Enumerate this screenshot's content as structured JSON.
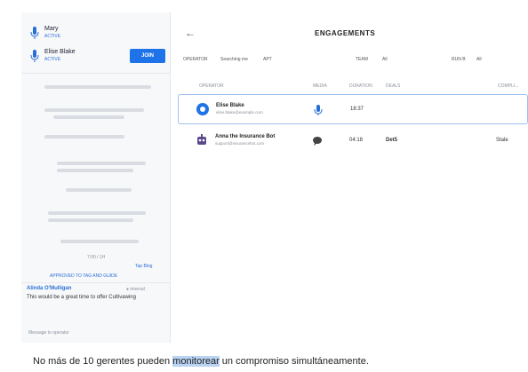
{
  "sidebar": {
    "agents": [
      {
        "name": "Mary",
        "status": "ACTIVE"
      },
      {
        "name": "Elise Blake",
        "status": "ACTIVE"
      }
    ],
    "join_label": "JOIN",
    "time_label": "7:00 / 1H",
    "show_link": "Tap Blog",
    "reply_link": "APPROVED TO TAG AND GUIDE",
    "chat": {
      "author": "Alinda O'Mulligan",
      "meta": "● internal",
      "message": "This would be a great time to offer Cultivawing"
    },
    "message_input": "Message to operator"
  },
  "main": {
    "back_icon": "arrow-left-icon",
    "title": "ENGAGEMENTS",
    "filters": [
      {
        "label": "OPERATOR"
      },
      {
        "label": "Searching me"
      },
      {
        "label": "APT"
      },
      {
        "label": "TEAM"
      },
      {
        "label": "All"
      },
      {
        "label": "RUN B"
      },
      {
        "label": "All"
      }
    ],
    "columns": [
      "OPERATOR",
      "MEDIA",
      "DURATION",
      "DEALS",
      "COMPLI..."
    ],
    "rows": [
      {
        "name": "Elise Blake",
        "email": "elise.blake@example.com",
        "avatar": "user-avatar-icon",
        "media": "microphone-icon",
        "duration": "18:37",
        "deal": "",
        "compliance": "",
        "selected": true
      },
      {
        "name": "Anna the Insurance Bot",
        "email": "support@insurancebot.com",
        "avatar": "robot-avatar-icon",
        "media": "chat-bubble-icon",
        "duration": "04:18",
        "deal": "Det5",
        "compliance": "Stale",
        "selected": false
      }
    ]
  },
  "caption": {
    "before": "No más de 10 gerentes pueden ",
    "highlight": "monitorear",
    "after": " un compromiso simultáneamente."
  },
  "colors": {
    "accent": "#1e73e8",
    "selected_border": "#9cc0f2",
    "highlight": "#b9d3f3"
  }
}
